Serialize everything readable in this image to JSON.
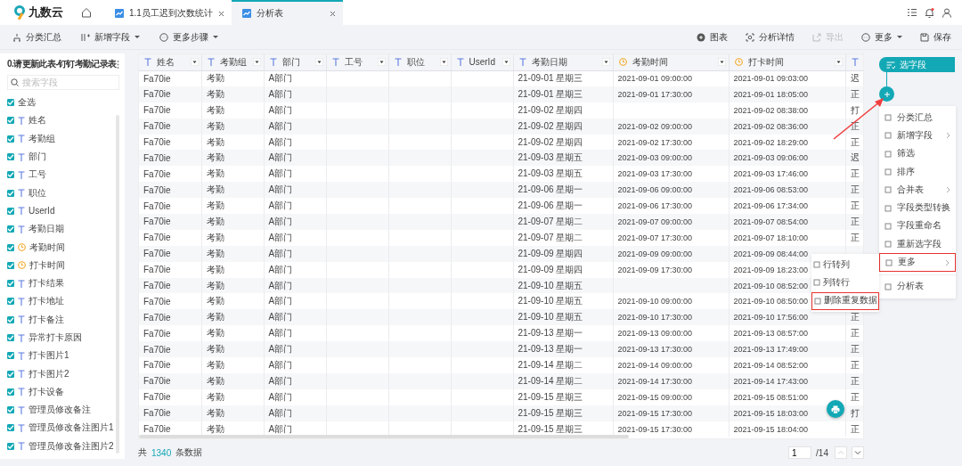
{
  "app": {
    "logo": "九数云"
  },
  "tabs": [
    {
      "label": "1.1员工迟到次数统计",
      "selected": false
    },
    {
      "label": "分析表",
      "selected": true
    }
  ],
  "toolbar": {
    "left": [
      {
        "label": "分类汇总",
        "disabled": false,
        "has_menu": false
      },
      {
        "label": "新增字段",
        "disabled": false,
        "has_menu": true
      },
      {
        "label": "更多步骤",
        "disabled": false,
        "has_menu": true
      }
    ],
    "right": [
      {
        "label": "图表",
        "disabled": false,
        "has_menu": false
      },
      {
        "label": "分析详情",
        "disabled": false,
        "has_menu": false
      },
      {
        "label": "导出",
        "disabled": true,
        "has_menu": false
      },
      {
        "label": "更多",
        "disabled": false,
        "has_menu": true
      },
      {
        "label": "保存",
        "disabled": false,
        "has_menu": false
      }
    ]
  },
  "sidebar": {
    "title": "0.请更新此表-钉钉考勤记录表",
    "search": {
      "placeholder": "搜索字段"
    },
    "select_all": {
      "label": "全选",
      "checked": true
    },
    "fields": [
      {
        "label": "姓名",
        "kind": "text",
        "checked": true
      },
      {
        "label": "考勤组",
        "kind": "text",
        "checked": true
      },
      {
        "label": "部门",
        "kind": "text",
        "checked": true
      },
      {
        "label": "工号",
        "kind": "text",
        "checked": true
      },
      {
        "label": "职位",
        "kind": "text",
        "checked": true
      },
      {
        "label": "UserId",
        "kind": "text",
        "checked": true
      },
      {
        "label": "考勤日期",
        "kind": "text",
        "checked": true
      },
      {
        "label": "考勤时间",
        "kind": "time",
        "checked": true
      },
      {
        "label": "打卡时间",
        "kind": "time",
        "checked": true
      },
      {
        "label": "打卡结果",
        "kind": "text",
        "checked": true
      },
      {
        "label": "打卡地址",
        "kind": "text",
        "checked": true
      },
      {
        "label": "打卡备注",
        "kind": "text",
        "checked": true
      },
      {
        "label": "异常打卡原因",
        "kind": "text",
        "checked": true
      },
      {
        "label": "打卡图片1",
        "kind": "text",
        "checked": true
      },
      {
        "label": "打卡图片2",
        "kind": "text",
        "checked": true
      },
      {
        "label": "打卡设备",
        "kind": "text",
        "checked": true
      },
      {
        "label": "管理员修改备注",
        "kind": "text",
        "checked": true
      },
      {
        "label": "管理员修改备注图片1",
        "kind": "text",
        "checked": true
      },
      {
        "label": "管理员修改备注图片2",
        "kind": "text",
        "checked": true
      }
    ]
  },
  "table": {
    "columns": [
      {
        "label": "姓名",
        "kind": "text"
      },
      {
        "label": "考勤组",
        "kind": "text"
      },
      {
        "label": "部门",
        "kind": "text"
      },
      {
        "label": "工号",
        "kind": "text"
      },
      {
        "label": "职位",
        "kind": "text"
      },
      {
        "label": "UserId",
        "kind": "text"
      },
      {
        "label": "考勤日期",
        "kind": "text"
      },
      {
        "label": "考勤时间",
        "kind": "time"
      },
      {
        "label": "打卡时间",
        "kind": "time"
      },
      {
        "kind": "text"
      }
    ],
    "rows": [
      {
        "cells": [
          "Fa70ie",
          "考勤",
          "A部门",
          "",
          "",
          "",
          "21-09-01 星期三",
          "2021-09-01 09:00:00",
          "2021-09-01 09:03:00",
          "迟"
        ]
      },
      {
        "cells": [
          "Fa70ie",
          "考勤",
          "A部门",
          "",
          "",
          "",
          "21-09-01 星期三",
          "2021-09-01 17:30:00",
          "2021-09-01 18:05:00",
          "正"
        ]
      },
      {
        "cells": [
          "Fa70ie",
          "考勤",
          "A部门",
          "",
          "",
          "",
          "21-09-02 星期四",
          "",
          "2021-09-02 08:38:00",
          "打"
        ]
      },
      {
        "cells": [
          "Fa70ie",
          "考勤",
          "A部门",
          "",
          "",
          "",
          "21-09-02 星期四",
          "2021-09-02 09:00:00",
          "2021-09-02 08:36:00",
          "正"
        ]
      },
      {
        "cells": [
          "Fa70ie",
          "考勤",
          "A部门",
          "",
          "",
          "",
          "21-09-02 星期四",
          "2021-09-02 17:30:00",
          "2021-09-02 18:29:00",
          "正"
        ]
      },
      {
        "cells": [
          "Fa70ie",
          "考勤",
          "A部门",
          "",
          "",
          "",
          "21-09-03 星期五",
          "2021-09-03 09:00:00",
          "2021-09-03 09:06:00",
          "迟"
        ]
      },
      {
        "cells": [
          "Fa70ie",
          "考勤",
          "A部门",
          "",
          "",
          "",
          "21-09-03 星期五",
          "2021-09-03 17:30:00",
          "2021-09-03 17:46:00",
          "正"
        ]
      },
      {
        "cells": [
          "Fa70ie",
          "考勤",
          "A部门",
          "",
          "",
          "",
          "21-09-06 星期一",
          "2021-09-06 09:00:00",
          "2021-09-06 08:53:00",
          "正"
        ]
      },
      {
        "cells": [
          "Fa70ie",
          "考勤",
          "A部门",
          "",
          "",
          "",
          "21-09-06 星期一",
          "2021-09-06 17:30:00",
          "2021-09-06 17:34:00",
          "正"
        ]
      },
      {
        "cells": [
          "Fa70ie",
          "考勤",
          "A部门",
          "",
          "",
          "",
          "21-09-07 星期二",
          "2021-09-07 09:00:00",
          "2021-09-07 08:54:00",
          "正"
        ]
      },
      {
        "cells": [
          "Fa70ie",
          "考勤",
          "A部门",
          "",
          "",
          "",
          "21-09-07 星期二",
          "2021-09-07 17:30:00",
          "2021-09-07 18:10:00",
          "正"
        ]
      },
      {
        "cells": [
          "Fa70ie",
          "考勤",
          "A部门",
          "",
          "",
          "",
          "21-09-09 星期四",
          "2021-09-09 09:00:00",
          "2021-09-09 08:44:00",
          ""
        ]
      },
      {
        "cells": [
          "Fa70ie",
          "考勤",
          "A部门",
          "",
          "",
          "",
          "21-09-09 星期四",
          "2021-09-09 17:30:00",
          "2021-09-09 18:23:00",
          ""
        ]
      },
      {
        "cells": [
          "Fa70ie",
          "考勤",
          "A部门",
          "",
          "",
          "",
          "21-09-10 星期五",
          "",
          "2021-09-10 08:52:00",
          ""
        ]
      },
      {
        "cells": [
          "Fa70ie",
          "考勤",
          "A部门",
          "",
          "",
          "",
          "21-09-10 星期五",
          "2021-09-10 09:00:00",
          "2021-09-10 08:50:00",
          ""
        ]
      },
      {
        "cells": [
          "Fa70ie",
          "考勤",
          "A部门",
          "",
          "",
          "",
          "21-09-10 星期五",
          "2021-09-10 17:30:00",
          "2021-09-10 17:56:00",
          "正"
        ]
      },
      {
        "cells": [
          "Fa70ie",
          "考勤",
          "A部门",
          "",
          "",
          "",
          "21-09-13 星期一",
          "2021-09-13 09:00:00",
          "2021-09-13 08:57:00",
          "正"
        ]
      },
      {
        "cells": [
          "Fa70ie",
          "考勤",
          "A部门",
          "",
          "",
          "",
          "21-09-13 星期一",
          "2021-09-13 17:30:00",
          "2021-09-13 17:49:00",
          "正"
        ]
      },
      {
        "cells": [
          "Fa70ie",
          "考勤",
          "A部门",
          "",
          "",
          "",
          "21-09-14 星期二",
          "2021-09-14 09:00:00",
          "2021-09-14 08:52:00",
          "正"
        ]
      },
      {
        "cells": [
          "Fa70ie",
          "考勤",
          "A部门",
          "",
          "",
          "",
          "21-09-14 星期二",
          "2021-09-14 17:30:00",
          "2021-09-14 17:43:00",
          "正"
        ]
      },
      {
        "cells": [
          "Fa70ie",
          "考勤",
          "A部门",
          "",
          "",
          "",
          "21-09-15 星期三",
          "2021-09-15 09:00:00",
          "2021-09-15 08:51:00",
          "正"
        ]
      },
      {
        "cells": [
          "Fa70ie",
          "考勤",
          "A部门",
          "",
          "",
          "",
          "21-09-15 星期三",
          "2021-09-15 17:30:00",
          "2021-09-15 18:03:00",
          "打"
        ]
      },
      {
        "cells": [
          "Fa70ie",
          "考勤",
          "A部门",
          "",
          "",
          "",
          "21-09-15 星期三",
          "2021-09-15 17:30:00",
          "2021-09-15 18:04:00",
          "正"
        ]
      }
    ]
  },
  "footer": {
    "prefix": "共",
    "count": "1340",
    "suffix": "条数据",
    "page": "1",
    "pages": "/14"
  },
  "flow": {
    "node": "选字段",
    "menu": [
      {
        "label": "分类汇总",
        "has_submenu": false,
        "highlighted": false
      },
      {
        "label": "新增字段",
        "has_submenu": true,
        "highlighted": false
      },
      {
        "label": "筛选",
        "has_submenu": false,
        "highlighted": false
      },
      {
        "label": "排序",
        "has_submenu": false,
        "highlighted": false
      },
      {
        "label": "合并表",
        "has_submenu": true,
        "highlighted": false
      },
      {
        "label": "字段类型转换",
        "has_submenu": false,
        "highlighted": false
      },
      {
        "label": "字段重命名",
        "has_submenu": false,
        "highlighted": false
      },
      {
        "label": "重新选字段",
        "has_submenu": false,
        "highlighted": false
      },
      {
        "label": "更多",
        "has_submenu": true,
        "highlighted": true
      },
      {
        "label": "分析表",
        "has_submenu": false,
        "highlighted": false
      }
    ],
    "submenu": [
      {
        "label": "行转列",
        "highlighted": false
      },
      {
        "label": "列转行",
        "highlighted": false
      },
      {
        "label": "删除重复数据",
        "highlighted": true
      }
    ]
  }
}
